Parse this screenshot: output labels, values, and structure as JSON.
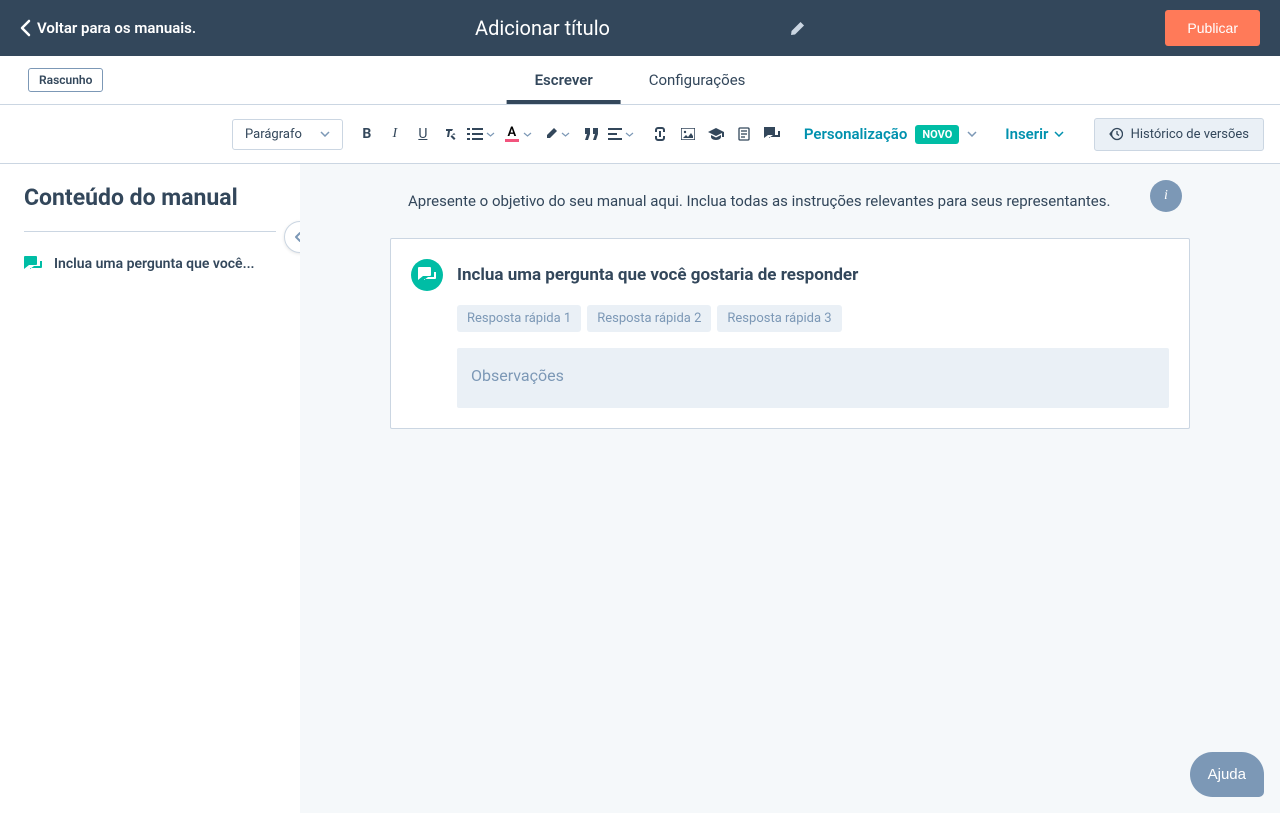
{
  "header": {
    "back_label": "Voltar para os manuais.",
    "title": "Adicionar título",
    "publish_label": "Publicar"
  },
  "tab_bar": {
    "draft_badge": "Rascunho",
    "tabs": [
      {
        "label": "Escrever",
        "active": true
      },
      {
        "label": "Configurações",
        "active": false
      }
    ]
  },
  "toolbar": {
    "format_selector": "Parágrafo",
    "personalization_label": "Personalização",
    "new_badge": "NOVO",
    "insert_label": "Inserir",
    "version_history_label": "Histórico de versões"
  },
  "sidebar": {
    "title": "Conteúdo do manual",
    "items": [
      {
        "label": "Inclua uma pergunta que você..."
      }
    ]
  },
  "editor": {
    "intro_text": "Apresente o objetivo do seu manual aqui. Inclua todas as instruções relevantes para seus representantes.",
    "question_card": {
      "title": "Inclua uma pergunta que você gostaria de responder",
      "quick_responses": [
        "Resposta rápida 1",
        "Resposta rápida 2",
        "Resposta rápida 3"
      ],
      "observations_placeholder": "Observações"
    }
  },
  "help_button": "Ajuda",
  "colors": {
    "header_bg": "#33475b",
    "primary_orange": "#ff7a59",
    "teal": "#00bda5",
    "link_blue": "#0091ae",
    "gray_blue": "#7c98b6"
  }
}
